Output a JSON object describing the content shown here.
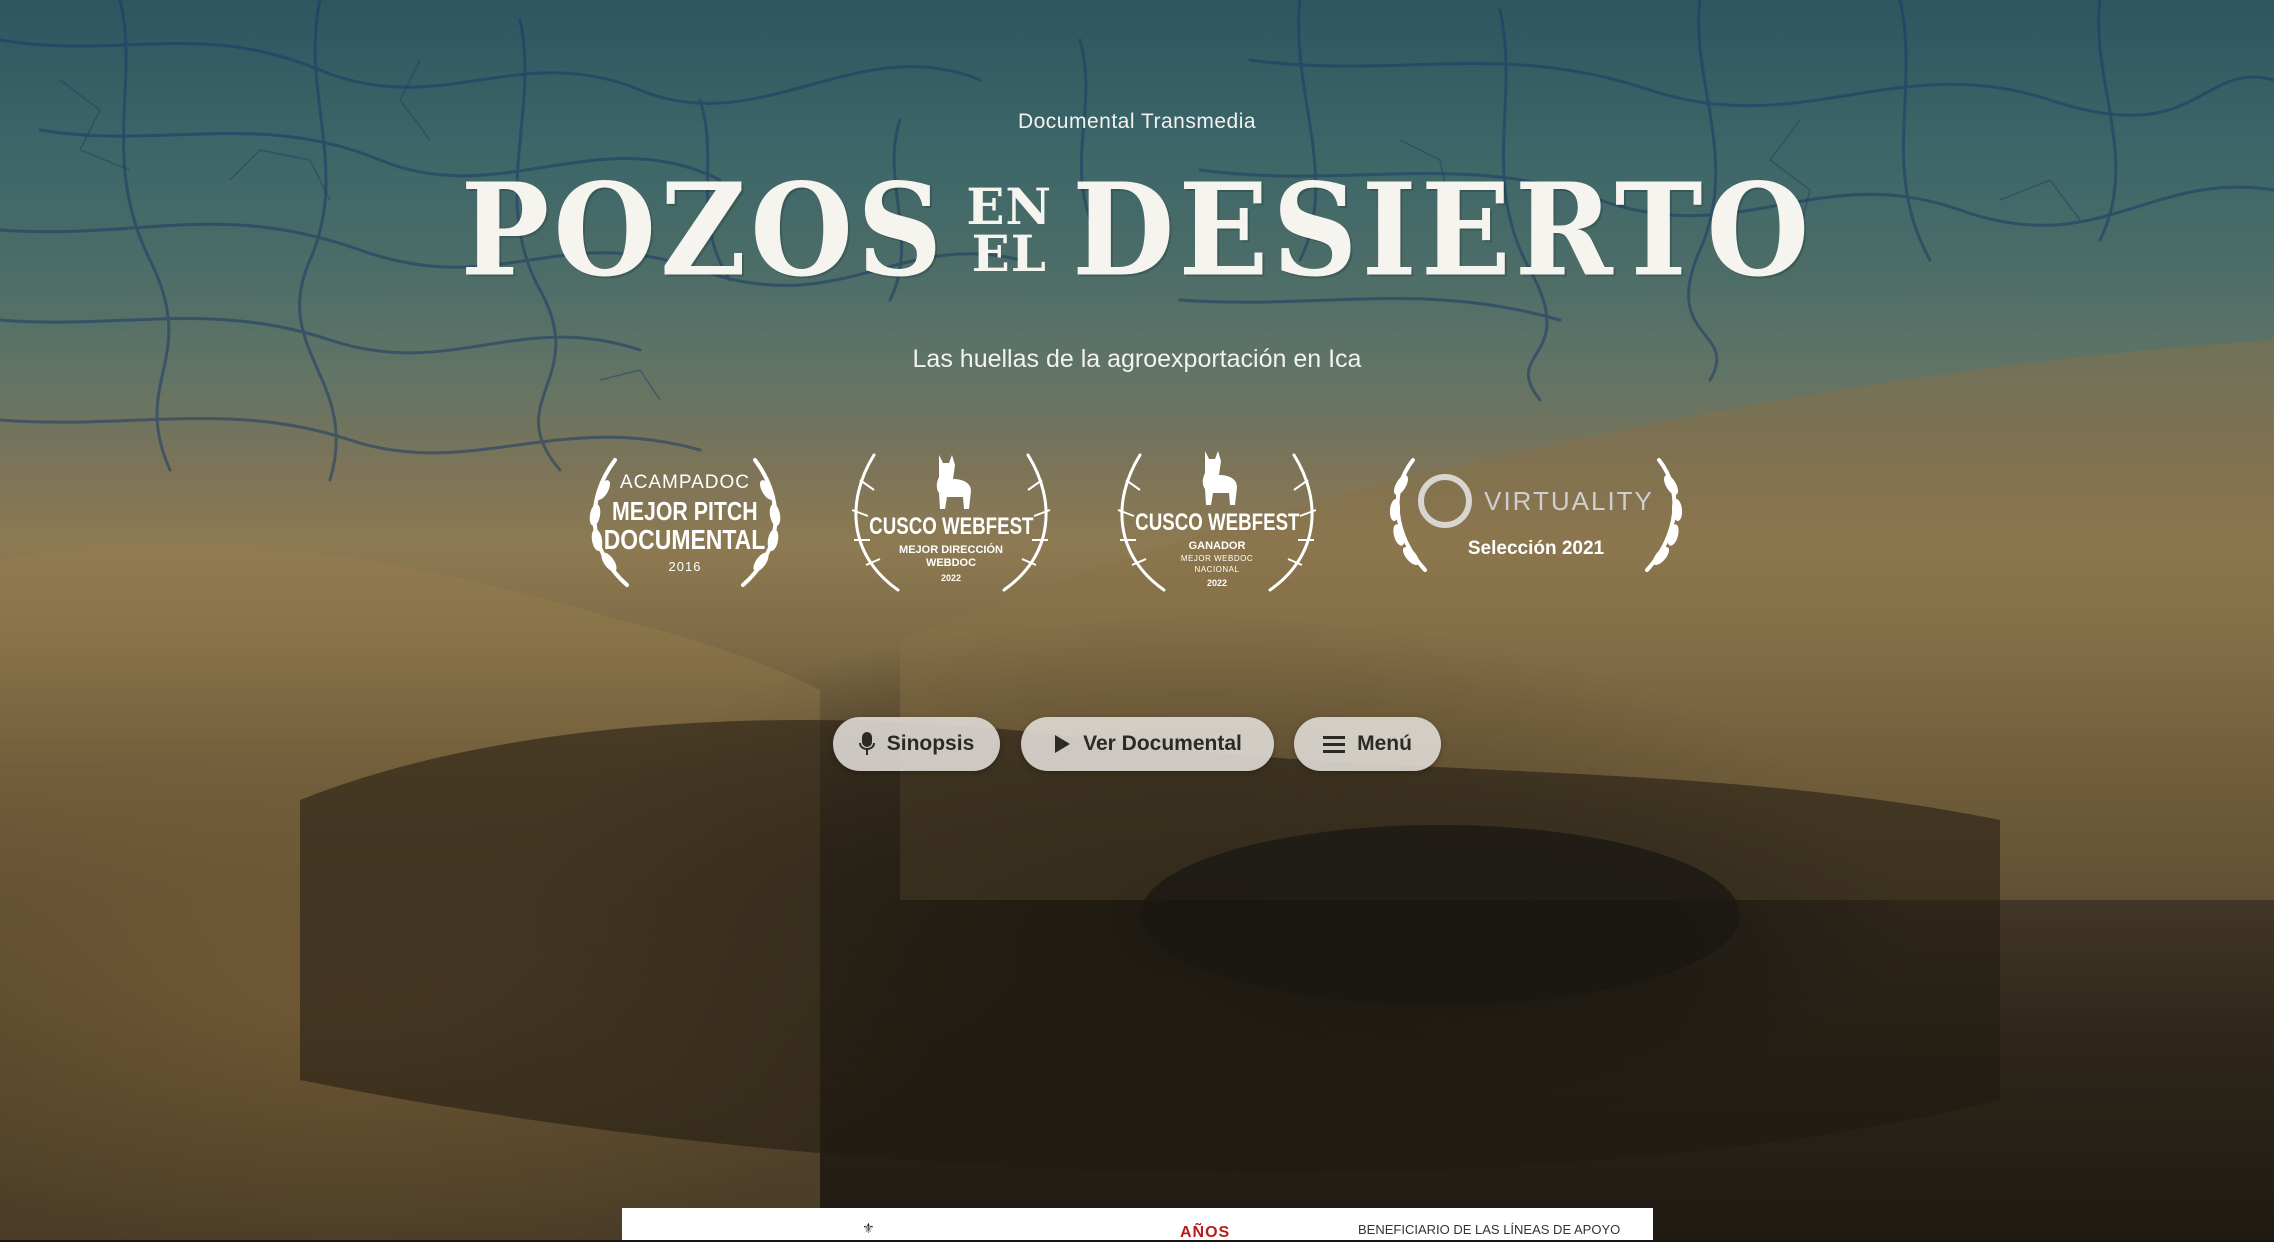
{
  "hero": {
    "eyebrow": "Documental Transmedia",
    "title_part1": "POZOS",
    "title_small_top": "EN",
    "title_small_bottom": "EL",
    "title_part2": "DESIERTO",
    "subtitle": "Las huellas de la agroexportación en Ica"
  },
  "awards": [
    {
      "line1": "ACAMPADOC",
      "line2": "MEJOR PITCH",
      "line3": "DOCUMENTAL",
      "line4": "2016"
    },
    {
      "line2": "CUSCO WEBFEST",
      "line3": "MEJOR DIRECCIÓN",
      "line4": "WEBDOC",
      "line5": "2022"
    },
    {
      "line2": "CUSCO WEBFEST",
      "line3": "GANADOR",
      "line4a": "MEJOR WEBDOC",
      "line4b": "NACIONAL",
      "line5": "2022"
    },
    {
      "brand": "VIRTUALITY",
      "selection": "Selección 2021"
    }
  ],
  "buttons": {
    "sinopsis": "Sinopsis",
    "ver_documental": "Ver Documental",
    "menu": "Menú"
  },
  "icons": {
    "sinopsis": "microphone-icon",
    "ver_documental": "play-icon",
    "menu": "hamburger-icon"
  },
  "sponsor": {
    "anos": "AÑOS",
    "text": "BENEFICIARIO DE LAS LÍNEAS DE APOYO"
  }
}
